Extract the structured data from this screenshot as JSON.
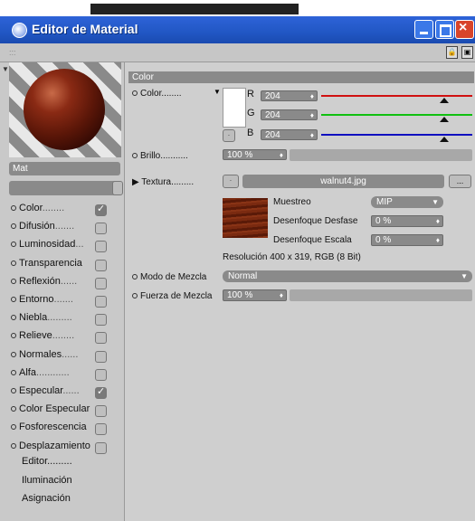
{
  "window": {
    "title": "Editor de Material",
    "accent": "#2157c4",
    "close_color": "#d8442a"
  },
  "toolbar": {
    "grip": ":::",
    "lock_icon": "lock-icon",
    "pin_icon": "pin-icon"
  },
  "material": {
    "name": "Mat"
  },
  "channels": [
    {
      "label": "Color",
      "dots": "........",
      "checked": true
    },
    {
      "label": "Difusión",
      "dots": ".......",
      "checked": false
    },
    {
      "label": "Luminosidad",
      "dots": "...",
      "checked": false
    },
    {
      "label": "Transparencia",
      "dots": "",
      "checked": false
    },
    {
      "label": "Reflexión",
      "dots": "......",
      "checked": false
    },
    {
      "label": "Entorno",
      "dots": ".......",
      "checked": false
    },
    {
      "label": "Niebla",
      "dots": ".........",
      "checked": false
    },
    {
      "label": "Relieve",
      "dots": "........",
      "checked": false
    },
    {
      "label": "Normales",
      "dots": "......",
      "checked": false
    },
    {
      "label": "Alfa",
      "dots": "............",
      "checked": false
    },
    {
      "label": "Especular",
      "dots": "......",
      "checked": true
    },
    {
      "label": "Color Especular",
      "dots": "",
      "checked": false
    },
    {
      "label": "Fosforescencia",
      "dots": "",
      "checked": false
    },
    {
      "label": "Desplazamiento",
      "dots": "",
      "checked": false
    }
  ],
  "extra_items": [
    {
      "label": "Editor........."
    },
    {
      "label": "Iluminación"
    },
    {
      "label": "Asignación"
    }
  ],
  "color_section": {
    "header": "Color",
    "color_label": "Color........",
    "swatch": "#ffffff",
    "r_label": "R",
    "r_value": "204",
    "g_label": "G",
    "g_value": "204",
    "b_label": "B",
    "b_value": "204",
    "r_color": "#d01010",
    "g_color": "#10c010",
    "b_color": "#1010c0",
    "brillo_label": "Brillo...........",
    "brillo_value": "100 %",
    "brillo_level": 1.0,
    "textura_label": "Textura.........",
    "texture_file": "walnut4.jpg",
    "more_button": "...",
    "muestreo_label": "Muestreo",
    "muestreo_value": "MIP",
    "desenfoque_desfase_label": "Desenfoque Desfase",
    "desenfoque_desfase_value": "0 %",
    "desenfoque_escala_label": "Desenfoque Escala",
    "desenfoque_escala_value": "0 %",
    "resolution": "Resolución 400 x 319, RGB (8 Bit)",
    "modo_label": "Modo de Mezcla",
    "modo_value": "Normal",
    "fuerza_label": "Fuerza de Mezcla",
    "fuerza_value": "100 %"
  }
}
